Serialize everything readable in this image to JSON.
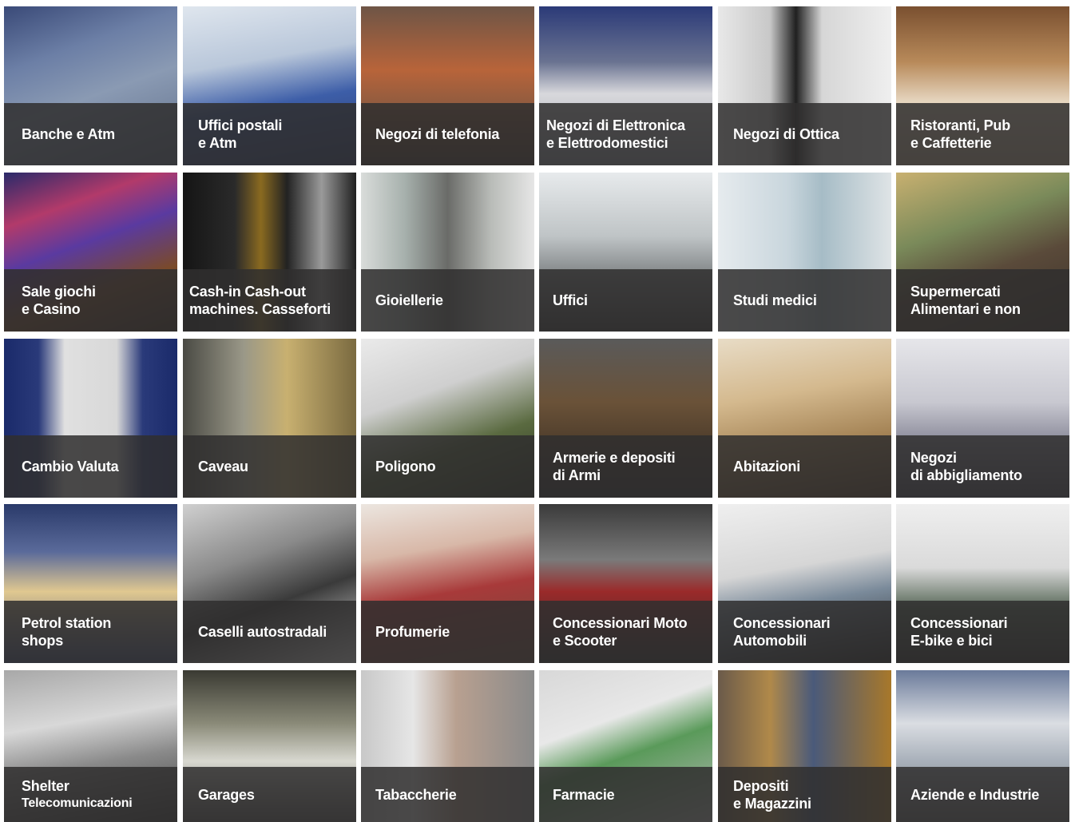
{
  "tiles": [
    {
      "line1": "Banche e Atm",
      "line2": "",
      "bg": "linear-gradient(160deg,#3a4a78 0%,#6c7fa6 30%,#8a9ab3 55%,#5e6d88 100%)"
    },
    {
      "line1": "Uffici postali",
      "line2": "e Atm",
      "bg": "linear-gradient(170deg,#dfe6ee 0%,#b9c7da 35%,#3d5ea8 60%,#2a3a6a 100%)"
    },
    {
      "line1": "Negozi di telefonia",
      "line2": "",
      "bg": "linear-gradient(180deg,#6e5546 0%,#b8643a 40%,#8a5a40 65%,#4a3a30 100%)"
    },
    {
      "line1": "Negozi di Elettronica",
      "line2": "e Elettrodomestici",
      "bg": "linear-gradient(180deg,#2b3a78 0%,#6a7391 35%,#d8d8dc 55%,#9aa0aa 100%)"
    },
    {
      "line1": "Negozi di Ottica",
      "line2": "",
      "bg": "linear-gradient(90deg,#e8e8e8 0%,#c8c8c8 30%,#202020 45%,#d6d6d6 60%,#efefef 100%)"
    },
    {
      "line1": "Ristoranti, Pub",
      "line2": "e Caffetterie",
      "bg": "linear-gradient(180deg,#7a5030 0%,#b88a5a 35%,#e6d6c0 60%,#c9b49a 100%)"
    },
    {
      "line1": "Sale giochi",
      "line2": "e Casino",
      "bg": "linear-gradient(160deg,#2a2a6a 0%,#b23a6a 25%,#5a3aa0 45%,#7a4a2a 70%,#3a2a20 100%)"
    },
    {
      "line1": "Cash-in Cash-out",
      "line2": "machines. Casseforti",
      "bg": "linear-gradient(90deg,#151515 0%,#2a2a2a 30%,#8a6a20 45%,#222 60%,#9a9a9a 80%,#202020 100%)"
    },
    {
      "line1": "Gioiellerie",
      "line2": "",
      "bg": "linear-gradient(90deg,#d9dcda 0%,#a7b1ad 25%,#6a6b68 50%,#b9bcb8 75%,#e6e6e6 100%)"
    },
    {
      "line1": "Uffici",
      "line2": "",
      "bg": "linear-gradient(180deg,#e7eaec 0%,#bfc4c6 40%,#808486 65%,#3a3a3a 100%)"
    },
    {
      "line1": "Studi medici",
      "line2": "",
      "bg": "linear-gradient(90deg,#e6ebee 0%,#c9d6dd 40%,#a6bcc6 60%,#dfe4e6 100%)"
    },
    {
      "line1": "Supermercati",
      "line2": "Alimentari e non",
      "bg": "linear-gradient(160deg,#c8b070 0%,#7a8a5a 35%,#5a4a3a 60%,#3a3028 100%)"
    },
    {
      "line1": "Cambio Valuta",
      "line2": "",
      "bg": "linear-gradient(90deg,#1a2a6a 0%,#2a3a7a 20%,#e0e0e0 35%,#d8d8d8 65%,#2a3a7a 80%,#1a2a6a 100%)"
    },
    {
      "line1": "Caveau",
      "line2": "",
      "bg": "linear-gradient(90deg,#4a4a44 0%,#9a9888 35%,#c8b070 60%,#7a6a40 100%)"
    },
    {
      "line1": "Poligono",
      "line2": "",
      "bg": "linear-gradient(160deg,#eaeaea 0%,#cfcfcf 35%,#5a6a40 65%,#2a3020 100%)"
    },
    {
      "line1": "Armerie e depositi",
      "line2": "di Armi",
      "bg": "linear-gradient(180deg,#5a5a5a 0%,#6a5238 40%,#4a3a2a 70%,#2a2a2a 100%)"
    },
    {
      "line1": "Abitazioni",
      "line2": "",
      "bg": "linear-gradient(170deg,#e8dcc6 0%,#d4b98e 35%,#a58456 65%,#5a4028 100%)"
    },
    {
      "line1": "Negozi",
      "line2": "di abbigliamento",
      "bg": "linear-gradient(180deg,#e6e6ea 0%,#c8c8d0 40%,#8a8a9a 65%,#4a4a58 100%)"
    },
    {
      "line1": "Petrol station",
      "line2": "shops",
      "bg": "linear-gradient(180deg,#2a3a6a 0%,#5a6a9a 30%,#e0c890 55%,#3a4a7a 100%)"
    },
    {
      "line1": "Caselli autostradali",
      "line2": "",
      "bg": "linear-gradient(160deg,#d0d0d0 0%,#8a8a8a 35%,#3a3a3a 60%,#e8e8e8 100%)"
    },
    {
      "line1": "Profumerie",
      "line2": "",
      "bg": "linear-gradient(170deg,#ece6e0 0%,#d8b8a8 30%,#a83a3a 55%,#6a4a3a 100%)"
    },
    {
      "line1": "Concessionari Moto",
      "line2": "e Scooter",
      "bg": "linear-gradient(180deg,#3a3a3a 0%,#7a7a7a 35%,#9a2a2a 55%,#2a2a2a 100%)"
    },
    {
      "line1": "Concessionari",
      "line2": "Automobili",
      "bg": "linear-gradient(170deg,#efefef 0%,#d6d6d6 40%,#7a8a9a 60%,#1e1e1e 100%)"
    },
    {
      "line1": "Concessionari",
      "line2": "E-bike e bici",
      "bg": "linear-gradient(180deg,#efefef 0%,#dadada 40%,#5a6a5a 65%,#2a2a2a 100%)"
    },
    {
      "line1": "Shelter",
      "line2": "Telecomunicazioni",
      "line2_small": true,
      "bg": "linear-gradient(170deg,#a8a8a8 0%,#d8d8d8 35%,#8a8a8a 60%,#3a3a3a 100%)"
    },
    {
      "line1": "Garages",
      "line2": "",
      "bg": "linear-gradient(180deg,#3a3a32 0%,#8a8a78 35%,#d8d8d0 60%,#5a5a5a 100%)"
    },
    {
      "line1": "Tabaccherie",
      "line2": "",
      "bg": "linear-gradient(90deg,#c8c8c8 0%,#e6e6e6 30%,#b8a090 55%,#8a8a8a 100%)"
    },
    {
      "line1": "Farmacie",
      "line2": "",
      "bg": "linear-gradient(160deg,#d8d8d8 0%,#e8e8e8 35%,#5a9a5a 55%,#bababa 100%)"
    },
    {
      "line1": "Depositi",
      "line2": "e Magazzini",
      "bg": "linear-gradient(90deg,#6a5a4a 0%,#b0894a 30%,#4a5a7a 55%,#a8782a 100%)"
    },
    {
      "line1": "Aziende e Industrie",
      "line2": "",
      "bg": "linear-gradient(180deg,#6a7a9a 0%,#dadde2 35%,#a8b0ba 60%,#6a6a6a 100%)"
    }
  ]
}
